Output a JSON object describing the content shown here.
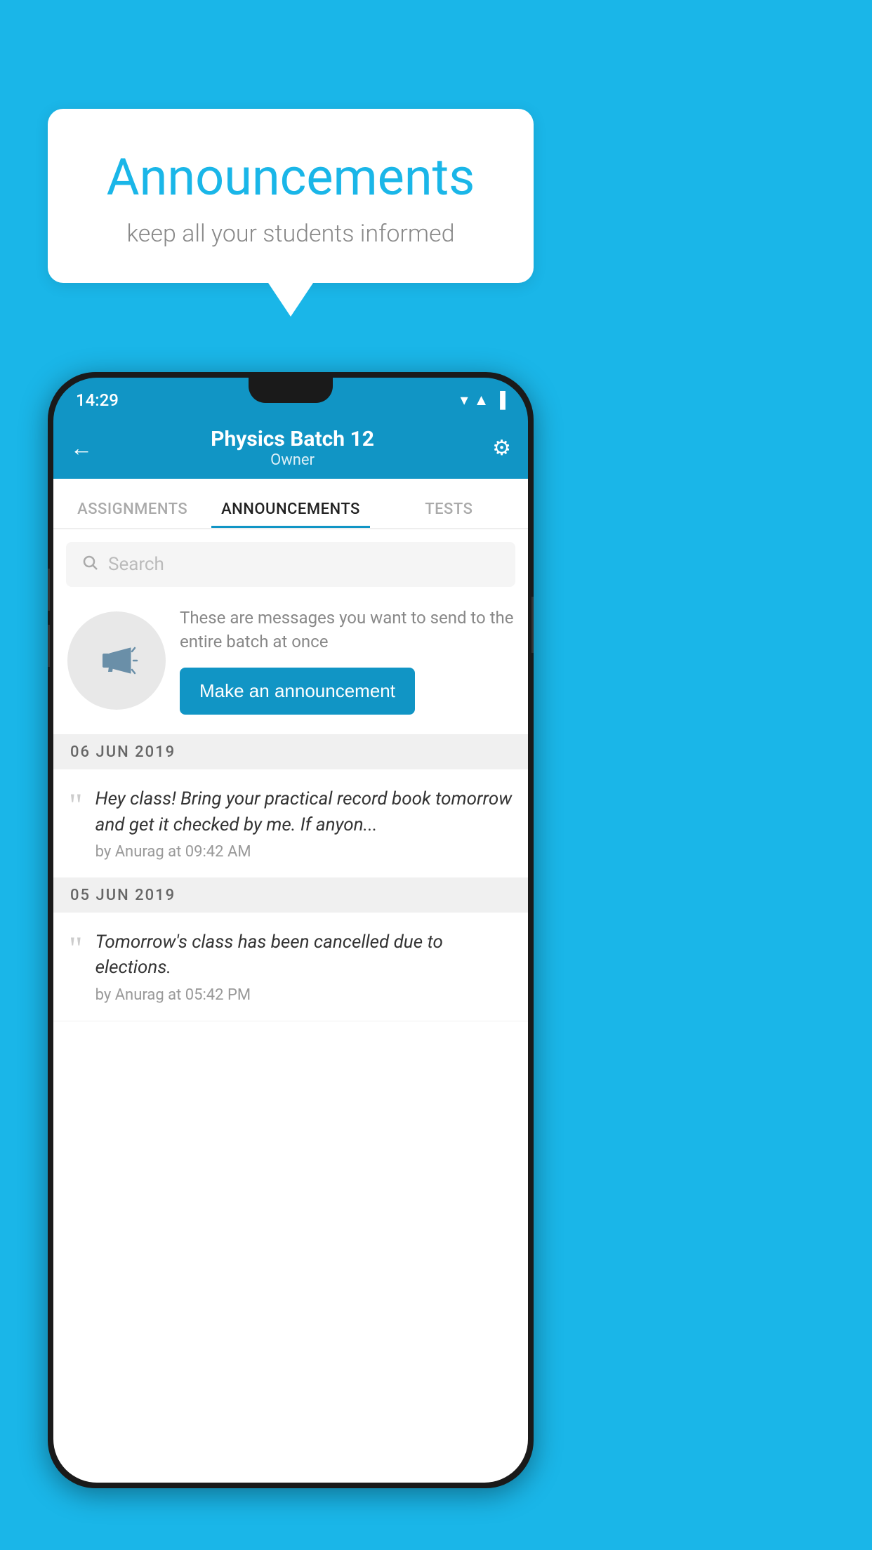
{
  "background_color": "#1ab6e8",
  "speech_bubble": {
    "title": "Announcements",
    "subtitle": "keep all your students informed"
  },
  "phone": {
    "status_bar": {
      "time": "14:29",
      "icons": "▼◀▐"
    },
    "app_bar": {
      "title": "Physics Batch 12",
      "subtitle": "Owner",
      "back_icon": "←",
      "settings_icon": "⚙"
    },
    "tabs": [
      {
        "label": "ASSIGNMENTS",
        "active": false
      },
      {
        "label": "ANNOUNCEMENTS",
        "active": true
      },
      {
        "label": "TESTS",
        "active": false
      },
      {
        "label": "",
        "active": false
      }
    ],
    "search": {
      "placeholder": "Search"
    },
    "promo": {
      "description": "These are messages you want to send to the entire batch at once",
      "button_label": "Make an announcement"
    },
    "announcements": [
      {
        "date": "06  JUN  2019",
        "message": "Hey class! Bring your practical record book tomorrow and get it checked by me. If anyon...",
        "meta": "by Anurag at 09:42 AM"
      },
      {
        "date": "05  JUN  2019",
        "message": "Tomorrow's class has been cancelled due to elections.",
        "meta": "by Anurag at 05:42 PM"
      }
    ]
  }
}
